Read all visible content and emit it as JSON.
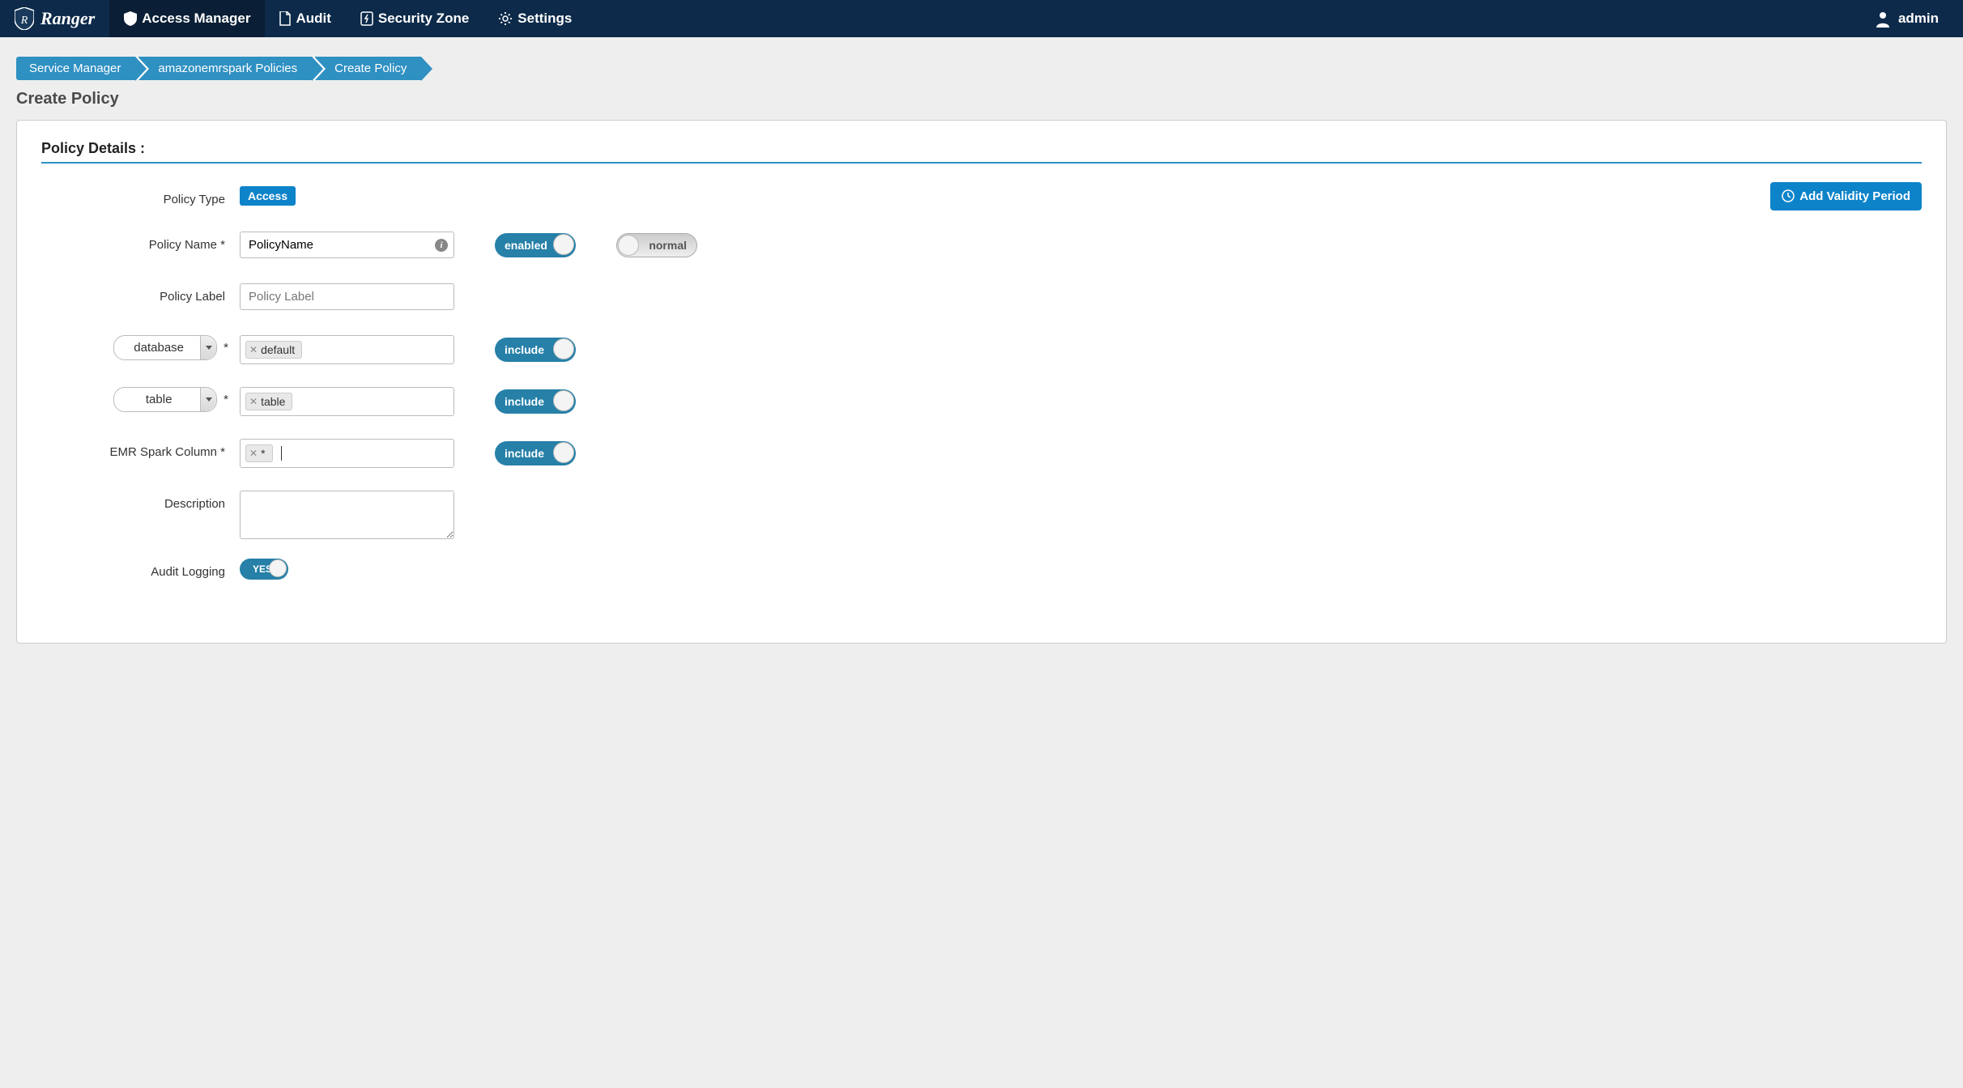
{
  "nav": {
    "brand": "Ranger",
    "items": {
      "access_manager": "Access Manager",
      "audit": "Audit",
      "security_zone": "Security Zone",
      "settings": "Settings"
    },
    "user": "admin"
  },
  "breadcrumb": {
    "service_manager": "Service Manager",
    "policies": "amazonemrspark Policies",
    "create": "Create Policy"
  },
  "page_title": "Create Policy",
  "section_title": "Policy Details :",
  "labels": {
    "policy_type": "Policy Type",
    "policy_name": "Policy Name *",
    "policy_label": "Policy Label",
    "database": "database",
    "table": "table",
    "spark_column": "EMR Spark Column *",
    "description": "Description",
    "audit_logging": "Audit Logging"
  },
  "values": {
    "policy_type_badge": "Access",
    "validity_button": "Add Validity Period",
    "policy_name_value": "PolicyName",
    "policy_label_placeholder": "Policy Label",
    "database_tag": "default",
    "table_tag": "table",
    "column_tag": "*"
  },
  "toggles": {
    "enabled": "enabled",
    "normal": "normal",
    "include": "include",
    "yes": "YES"
  }
}
